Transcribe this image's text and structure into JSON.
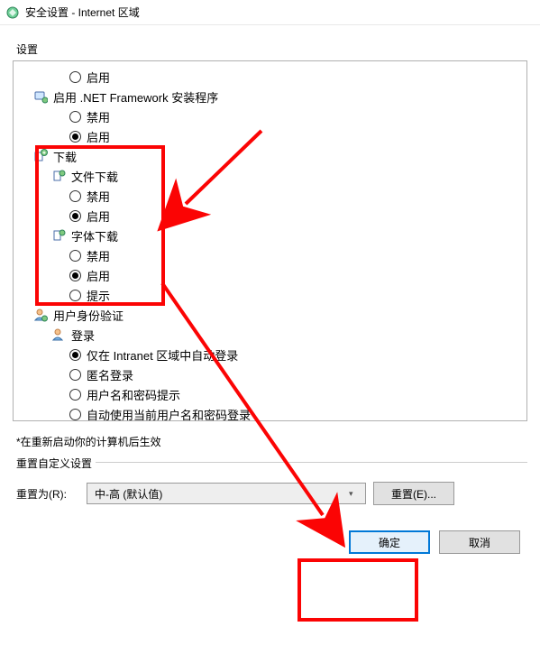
{
  "window": {
    "title": "安全设置 - Internet 区域"
  },
  "settings_label": "设置",
  "tree": {
    "enable_top": "启用",
    "net_framework": {
      "label": "启用 .NET Framework 安装程序",
      "disable": "禁用",
      "enable": "启用"
    },
    "download": {
      "label": "下载",
      "file": {
        "label": "文件下载",
        "disable": "禁用",
        "enable": "启用"
      },
      "font": {
        "label": "字体下载",
        "disable": "禁用",
        "enable": "启用",
        "prompt": "提示"
      }
    },
    "auth": {
      "label": "用户身份验证",
      "login": {
        "label": "登录",
        "intranet": "仅在 Intranet 区域中自动登录",
        "anon": "匿名登录",
        "prompt": "用户名和密码提示",
        "auto": "自动使用当前用户名和密码登录"
      }
    }
  },
  "restart_note": "*在重新启动你的计算机后生效",
  "reset": {
    "legend": "重置自定义设置",
    "label": "重置为(R):",
    "combo": "中-高 (默认值)",
    "button": "重置(E)..."
  },
  "buttons": {
    "ok": "确定",
    "cancel": "取消"
  }
}
